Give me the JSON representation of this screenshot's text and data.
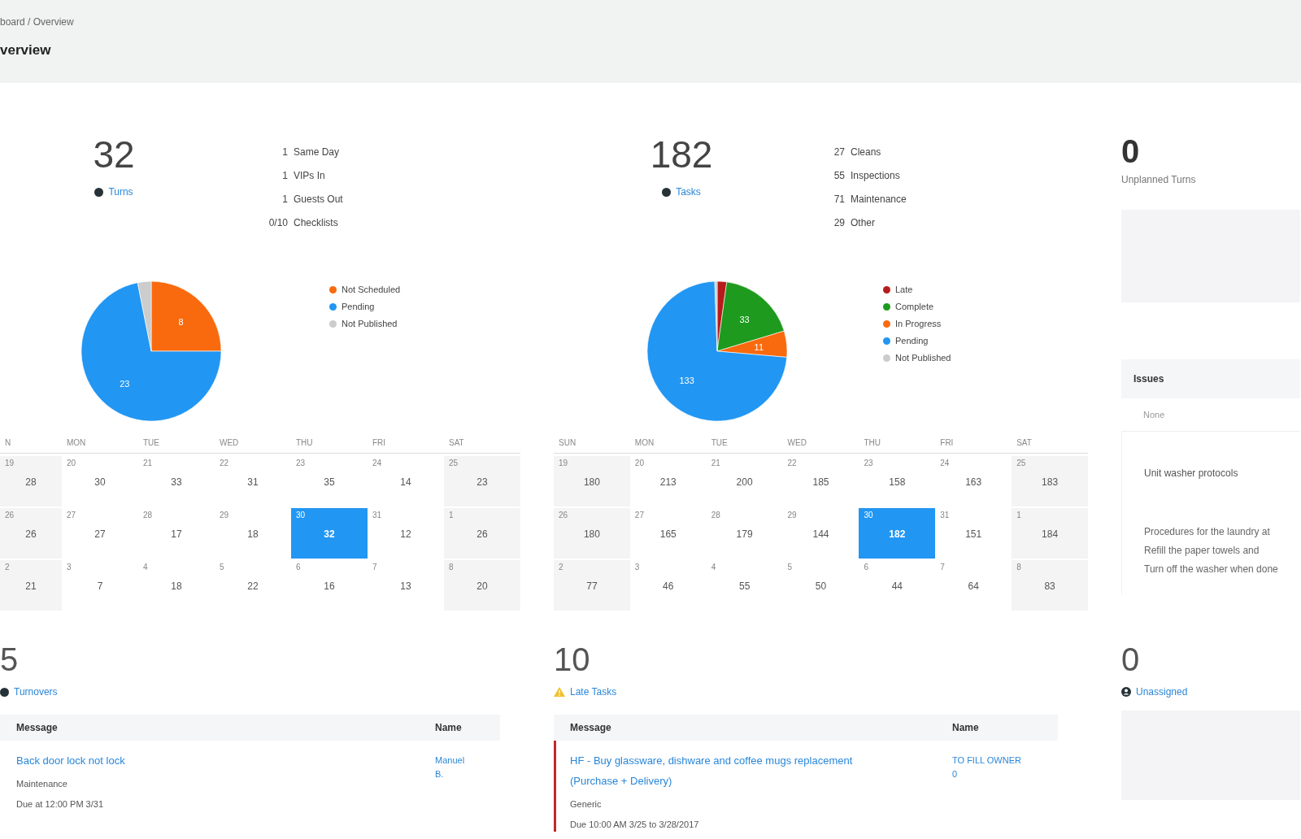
{
  "header": {
    "breadcrumb": "board / Overview",
    "title": "verview"
  },
  "panels": [
    {
      "stat": {
        "value": "32",
        "label": "Turns"
      },
      "breakdown": [
        {
          "count": "1",
          "label": "Same Day"
        },
        {
          "count": "1",
          "label": "VIPs In"
        },
        {
          "count": "1",
          "label": "Guests Out"
        },
        {
          "count": "0/10",
          "label": "Checklists"
        }
      ],
      "chart_data": {
        "type": "pie",
        "categories": [
          "Not Scheduled",
          "Pending",
          "Not Published"
        ],
        "values": [
          8,
          23,
          1
        ],
        "colors": [
          "#f96a0e",
          "#2196f3",
          "#cccccc"
        ],
        "value_labels": [
          "8",
          "23",
          null
        ]
      },
      "calendar": {
        "weekdays": [
          "N",
          "MON",
          "TUE",
          "WED",
          "THU",
          "FRI",
          "SAT"
        ],
        "weeks": [
          [
            {
              "date": "19",
              "count": "28",
              "today": false
            },
            {
              "date": "20",
              "count": "30",
              "today": false
            },
            {
              "date": "21",
              "count": "33",
              "today": false
            },
            {
              "date": "22",
              "count": "31",
              "today": false
            },
            {
              "date": "23",
              "count": "35",
              "today": false
            },
            {
              "date": "24",
              "count": "14",
              "today": false
            },
            {
              "date": "25",
              "count": "23",
              "today": false
            }
          ],
          [
            {
              "date": "26",
              "count": "26",
              "today": false
            },
            {
              "date": "27",
              "count": "27",
              "today": false
            },
            {
              "date": "28",
              "count": "17",
              "today": false
            },
            {
              "date": "29",
              "count": "18",
              "today": false
            },
            {
              "date": "30",
              "count": "32",
              "today": true
            },
            {
              "date": "31",
              "count": "12",
              "today": false
            },
            {
              "date": "1",
              "count": "26",
              "today": false
            }
          ],
          [
            {
              "date": "2",
              "count": "21",
              "today": false
            },
            {
              "date": "3",
              "count": "7",
              "today": false
            },
            {
              "date": "4",
              "count": "18",
              "today": false
            },
            {
              "date": "5",
              "count": "22",
              "today": false
            },
            {
              "date": "6",
              "count": "16",
              "today": false
            },
            {
              "date": "7",
              "count": "13",
              "today": false
            },
            {
              "date": "8",
              "count": "20",
              "today": false
            }
          ]
        ]
      }
    },
    {
      "stat": {
        "value": "182",
        "label": "Tasks"
      },
      "breakdown": [
        {
          "count": "27",
          "label": "Cleans"
        },
        {
          "count": "55",
          "label": "Inspections"
        },
        {
          "count": "71",
          "label": "Maintenance"
        },
        {
          "count": "29",
          "label": "Other"
        }
      ],
      "chart_data": {
        "type": "pie",
        "categories": [
          "Late",
          "Complete",
          "In Progress",
          "Pending",
          "Not Published"
        ],
        "values": [
          4,
          33,
          11,
          133,
          1
        ],
        "colors": [
          "#b71c1c",
          "#1e9a1e",
          "#f96a0e",
          "#2196f3",
          "#cccccc"
        ],
        "value_labels": [
          null,
          "33",
          "11",
          "133",
          null
        ]
      },
      "calendar": {
        "weekdays": [
          "SUN",
          "MON",
          "TUE",
          "WED",
          "THU",
          "FRI",
          "SAT"
        ],
        "weeks": [
          [
            {
              "date": "19",
              "count": "180",
              "today": false
            },
            {
              "date": "20",
              "count": "213",
              "today": false
            },
            {
              "date": "21",
              "count": "200",
              "today": false
            },
            {
              "date": "22",
              "count": "185",
              "today": false
            },
            {
              "date": "23",
              "count": "158",
              "today": false
            },
            {
              "date": "24",
              "count": "163",
              "today": false
            },
            {
              "date": "25",
              "count": "183",
              "today": false
            }
          ],
          [
            {
              "date": "26",
              "count": "180",
              "today": false
            },
            {
              "date": "27",
              "count": "165",
              "today": false
            },
            {
              "date": "28",
              "count": "179",
              "today": false
            },
            {
              "date": "29",
              "count": "144",
              "today": false
            },
            {
              "date": "30",
              "count": "182",
              "today": true
            },
            {
              "date": "31",
              "count": "151",
              "today": false
            },
            {
              "date": "1",
              "count": "184",
              "today": false
            }
          ],
          [
            {
              "date": "2",
              "count": "77",
              "today": false
            },
            {
              "date": "3",
              "count": "46",
              "today": false
            },
            {
              "date": "4",
              "count": "55",
              "today": false
            },
            {
              "date": "5",
              "count": "50",
              "today": false
            },
            {
              "date": "6",
              "count": "44",
              "today": false
            },
            {
              "date": "7",
              "count": "64",
              "today": false
            },
            {
              "date": "8",
              "count": "83",
              "today": false
            }
          ]
        ]
      }
    }
  ],
  "unplanned": {
    "value": "0",
    "label": "Unplanned Turns",
    "table": {
      "column": "Issues",
      "rows": [
        "None"
      ]
    },
    "note": {
      "title": "Unit washer protocols",
      "text": "Procedures for the laundry at\nRefill the paper towels and\nTurn off the washer when done"
    }
  },
  "lists": [
    {
      "kind": "table",
      "value": "5",
      "label": "Turnovers",
      "alert": false,
      "columns": [
        "Message",
        "Name"
      ],
      "rows": [
        {
          "title": "Back door lock not lock",
          "type": "Maintenance",
          "due": "Due at 12:00 PM 3/31",
          "assignee": [
            "Manuel",
            "B."
          ],
          "late": false
        }
      ]
    },
    {
      "kind": "table",
      "value": "10",
      "label": "Late Tasks",
      "alert": true,
      "columns": [
        "Message",
        "Name"
      ],
      "rows": [
        {
          "title": "HF - Buy glassware, dishware and coffee mugs replacement (Purchase + Delivery)",
          "type": "Generic",
          "due": "Due 10:00 AM 3/25 to 3/28/2017",
          "assignee": [
            "TO FILL OWNER",
            "0"
          ],
          "late": true
        }
      ]
    },
    {
      "kind": "empty",
      "value": "0",
      "label": "Unassigned",
      "alert": false
    }
  ]
}
